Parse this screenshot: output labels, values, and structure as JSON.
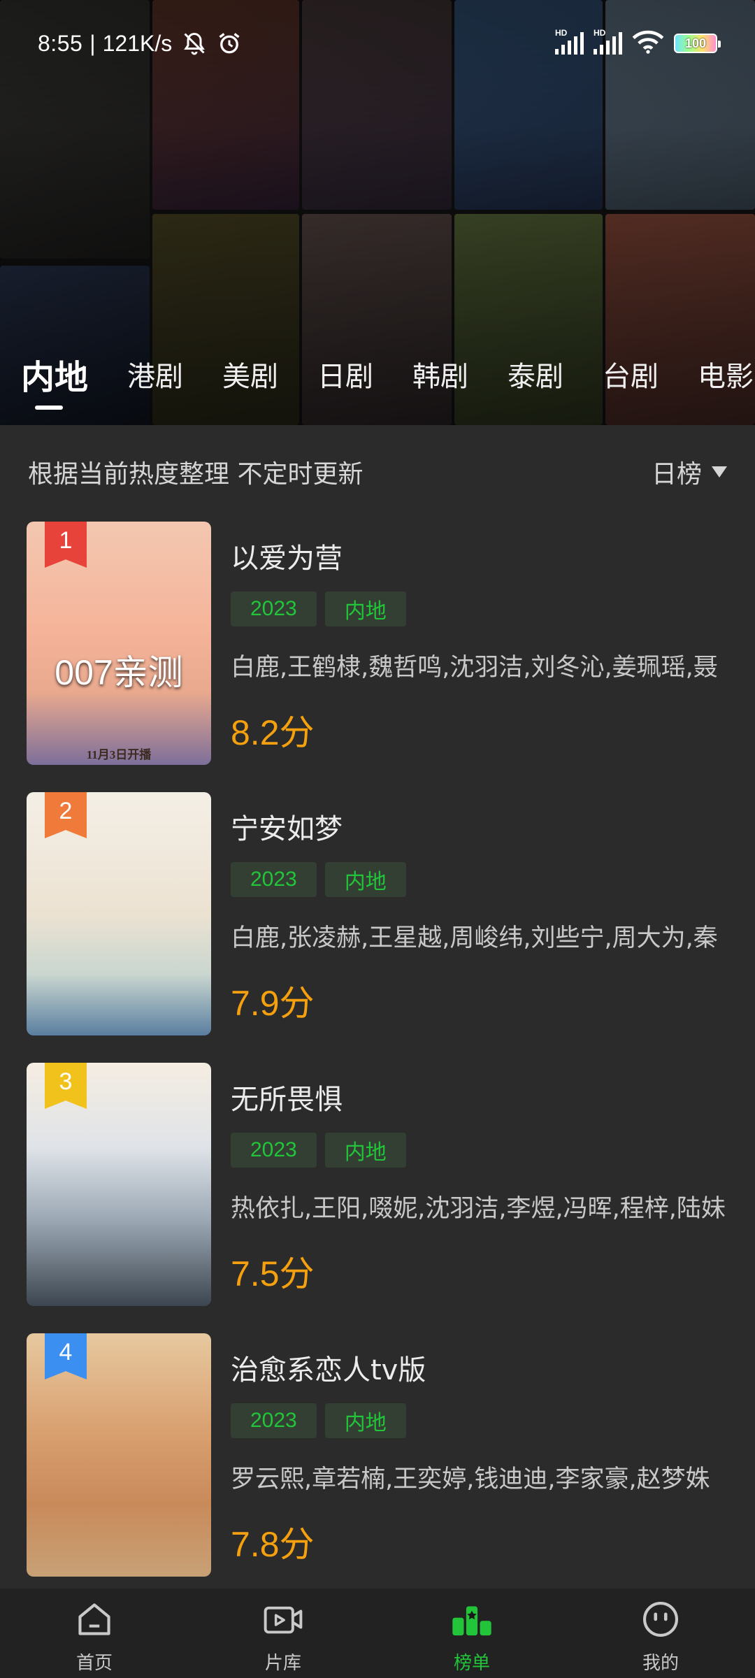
{
  "status_bar": {
    "time": "8:55",
    "separator": "|",
    "net_speed": "121K/s",
    "battery": "100",
    "icons": [
      "silent-icon",
      "alarm-icon",
      "hd-signal-icon",
      "hd-signal-icon",
      "wifi-icon",
      "battery-icon"
    ]
  },
  "tabs": [
    {
      "label": "内地",
      "active": true
    },
    {
      "label": "港剧",
      "active": false
    },
    {
      "label": "美剧",
      "active": false
    },
    {
      "label": "日剧",
      "active": false
    },
    {
      "label": "韩剧",
      "active": false
    },
    {
      "label": "泰剧",
      "active": false
    },
    {
      "label": "台剧",
      "active": false
    },
    {
      "label": "电影",
      "active": false
    }
  ],
  "list_header": {
    "subtitle": "根据当前热度整理 不定时更新",
    "rank_type": "日榜"
  },
  "items": [
    {
      "rank": "1",
      "badge_color": "#e8433a",
      "title": "以爱为营",
      "year": "2023",
      "region": "内地",
      "cast": "白鹿,王鹤棣,魏哲鸣,沈羽洁,刘冬沁,姜珮瑶,聂",
      "score": "8.2分",
      "poster_overlay": "007亲测",
      "poster_caption": "11月3日开播",
      "poster_colors": [
        "#f5b49a",
        "#f0d7c4",
        "#7d6f9a"
      ]
    },
    {
      "rank": "2",
      "badge_color": "#f07a3a",
      "title": "宁安如梦",
      "year": "2023",
      "region": "内地",
      "cast": "白鹿,张凌赫,王星越,周峻纬,刘些宁,周大为,秦",
      "score": "7.9分",
      "poster_overlay": "",
      "poster_caption": "",
      "poster_colors": [
        "#f4efe6",
        "#e9dfcf",
        "#5a7fa0"
      ]
    },
    {
      "rank": "3",
      "badge_color": "#f2c21c",
      "title": "无所畏惧",
      "year": "2023",
      "region": "内地",
      "cast": "热依扎,王阳,啜妮,沈羽洁,李煜,冯晖,程梓,陆妹",
      "score": "7.5分",
      "poster_overlay": "",
      "poster_caption": "",
      "poster_colors": [
        "#f4f2ee",
        "#b9c3cc",
        "#3d4650"
      ]
    },
    {
      "rank": "4",
      "badge_color": "#3a8ff0",
      "title": "治愈系恋人tv版",
      "year": "2023",
      "region": "内地",
      "cast": "罗云熙,章若楠,王奕婷,钱迪迪,李家豪,赵梦姝",
      "score": "7.8分",
      "poster_overlay": "",
      "poster_caption": "",
      "poster_colors": [
        "#e7c9a0",
        "#d98d5f",
        "#c7a176"
      ]
    }
  ],
  "bottom_nav": [
    {
      "label": "首页",
      "icon": "home-icon",
      "active": false
    },
    {
      "label": "片库",
      "icon": "video-library-icon",
      "active": false
    },
    {
      "label": "榜单",
      "icon": "ranking-icon",
      "active": true
    },
    {
      "label": "我的",
      "icon": "profile-icon",
      "active": false
    }
  ],
  "colors": {
    "accent_green": "#22c43a",
    "score_orange": "#f5a00f",
    "background": "#2b2b2b",
    "nav_background": "#222222"
  }
}
